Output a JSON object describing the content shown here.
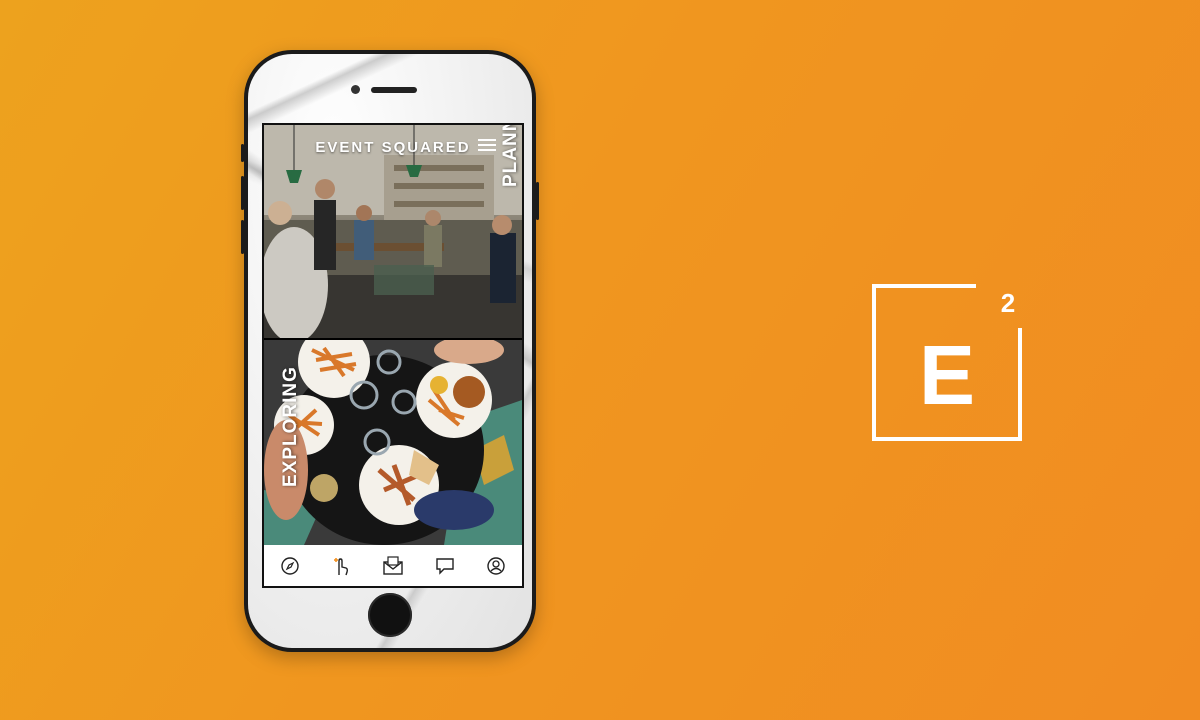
{
  "app": {
    "title": "EVENT SQUARED",
    "panels": [
      {
        "label": "PLANNING"
      },
      {
        "label": "EXPLORING"
      }
    ],
    "tabs": [
      {
        "icon": "compass-icon"
      },
      {
        "icon": "tap-icon"
      },
      {
        "icon": "envelope-icon"
      },
      {
        "icon": "chat-icon"
      },
      {
        "icon": "profile-icon"
      }
    ]
  },
  "logo": {
    "letter": "E",
    "superscript": "2"
  },
  "colors": {
    "background": "#f0961f",
    "accent": "#f39323",
    "tab_active": "#f39323"
  }
}
